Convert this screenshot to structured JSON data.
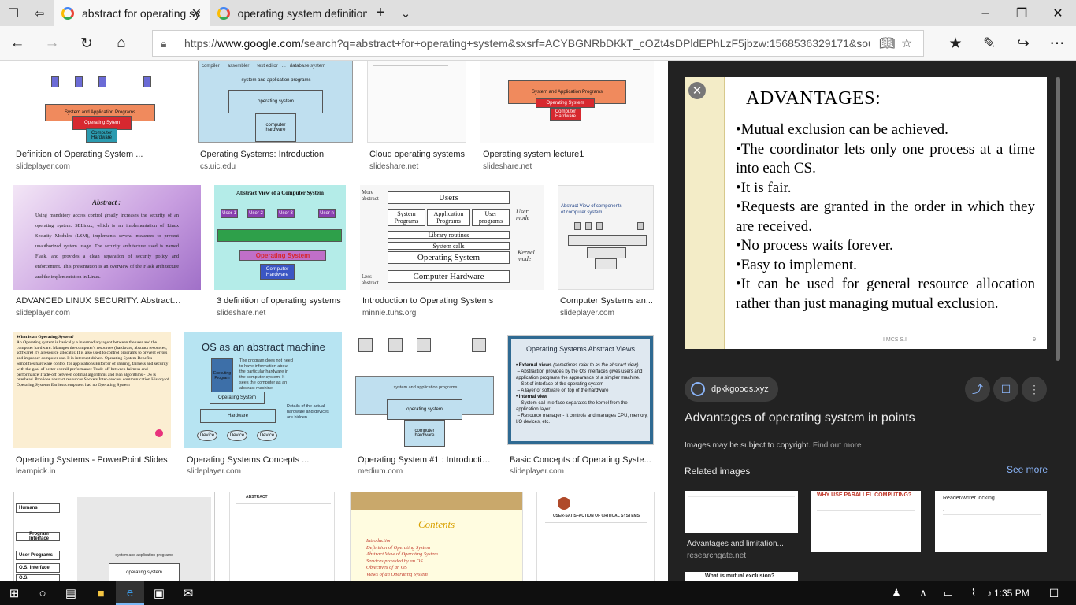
{
  "tabs": [
    {
      "title": "abstract for operating sy",
      "active": true
    },
    {
      "title": "operating system definition",
      "active": false
    }
  ],
  "address": {
    "url_prefix": "https://",
    "url_host": "www.google.com",
    "url_rest": "/search?q=abstract+for+operating+system&sxsrf=ACYBGNRbDKkT_cOZt4sDPldEPhLzF5jbzw:1568536329171&source=lnms&tl"
  },
  "results": [
    {
      "title": "Definition of Operating System ...",
      "source": "slideplayer.com"
    },
    {
      "title": "Operating Systems: Introduction",
      "source": "cs.uic.edu"
    },
    {
      "title": "Cloud operating systems",
      "source": "slideshare.net"
    },
    {
      "title": "Operating system lecture1",
      "source": "slideshare.net"
    },
    {
      "title": "ADVANCED LINUX SECURITY. Abstract ...",
      "source": "slideplayer.com"
    },
    {
      "title": "3 definition of operating systems",
      "source": "slideshare.net"
    },
    {
      "title": "Introduction to Operating Systems",
      "source": "minnie.tuhs.org"
    },
    {
      "title": "Computer Systems an...",
      "source": "slideplayer.com"
    },
    {
      "title": "Operating Systems - PowerPoint Slides",
      "source": "learnpick.in"
    },
    {
      "title": "Operating Systems Concepts ...",
      "source": "slideplayer.com"
    },
    {
      "title": "Operating System #1 : Introductio...",
      "source": "medium.com"
    },
    {
      "title": "Basic Concepts of Operating Syste...",
      "source": "slideplayer.com"
    }
  ],
  "thumbs": {
    "t1": {
      "sys": "System and Application Programs",
      "os": "Operating Sytem",
      "hw": "Computer Hardware"
    },
    "t2": {
      "compiler": "compiler",
      "assembler": "assembler",
      "text_editor": "text editor",
      "database": "database system",
      "sap": "system and application programs",
      "os": "operating system",
      "hw": "computer hardware"
    },
    "t4": {
      "sap": "System and Application Programs",
      "os": "Operating System",
      "hw": "Computer Hardware"
    },
    "t5": {
      "head": "Abstract :",
      "body": "Using mandatory access control greatly increases the security of an operating system. SELinux, which is an implementation of Linux Security Modules (LSM), implements several measures to prevent unauthorized system usage. The security architecture used is named Flask, and provides a clean separation of security policy and enforcement. This presentation is an overview of the Flask architecture and the implementation in Linux."
    },
    "t6": {
      "title": "Abstract View of a Computer System",
      "os": "Operating System",
      "hw": "Computer Hardware"
    },
    "t7": {
      "more": "More abstract",
      "less": "Less abstract",
      "users": "Users",
      "sys_prog": "System Programs",
      "app_prog": "Application Programs",
      "user_prog": "User programs",
      "user_mode": "User mode",
      "libs": "Library routines",
      "calls": "System calls",
      "os": "Operating System",
      "kernel": "Kernel mode",
      "hw": "Computer Hardware"
    },
    "t8": {
      "title": "Abstract View of components of computer system"
    },
    "t9": {
      "head": "What is an Operating System?",
      "body": "An Operating system is basically a intermediary agent between the user and the computer hardware. Manages the computer's resources (hardware, abstract resources, software) It's a resource allocator. It is also used to control programs to prevent errors and improper computer use. It is interrupt driven. Operating System Benefits Simplifies hardware control for applications Enforcer of sharing, fairness and security with the goal of better overall performance Trade-off between fairness and performance Trade-off between optimal algorithms and lean algorithms - OS is overhead. Provides abstract resources Sockets Inter-process communication History of Operating Systems Earliest computers had no Operating System"
    },
    "t10": {
      "title": "OS as an abstract machine",
      "desc": "The program does not need to have information about the particular hardware in the computer system. It sees the computer as an abstract machine.",
      "prog": "Executing Program",
      "os": "Operating System",
      "hw": "Hardware",
      "details": "Details of the actual hardware and devices are hidden.",
      "device": "Device"
    },
    "t12": {
      "title": "Operating Systems Abstract Views",
      "ext": "External views",
      "ext_note": "(sometimes refer to as the abstract view)",
      "b1": "Abstraction provides by the OS interfaces gives users and application programs the appearance of a simpler machine.",
      "b2": "Set of interface of the operating system",
      "b3": "A layer of software on top of the hardware",
      "int": "Internal view",
      "b4": "System call interface separates the kernel from the application layer",
      "b5": "Resource manager - It controls and manages CPU, memory, I/O devices, etc."
    },
    "t13": {
      "humans": "Humans",
      "pi": "Program Interface",
      "up": "User Programs",
      "osi": "O.S. Interface",
      "os": "O.S.",
      "sap": "system and application programs",
      "osys": "operating system"
    },
    "t14": {
      "head": "ABSTRACT"
    },
    "t15": {
      "contents": "Contents",
      "items": [
        "Introduction",
        "Definition of Operating System",
        "Abstract View of Operating System",
        "Services provided by an OS",
        "Objectives of an OS",
        "Views of an Operating System"
      ]
    },
    "t16": {
      "head": "USER-SATISFACTION OF CRITICAL SYSTEMS"
    }
  },
  "preview": {
    "slide_title": "ADVANTAGES:",
    "bullets": [
      "•Mutual exclusion can be achieved.",
      "•The coordinator lets only one process at a time into each CS.",
      "•It is fair.",
      "•Requests are granted in the order in which they are received.",
      "•No process waits forever.",
      "•Easy to implement.",
      "•It can be used for general resource allocation rather than just managing mutual exclusion."
    ],
    "footer": "I MCS S.I",
    "page": "9",
    "source_domain": "dpkkgoods.xyz",
    "title": "Advantages of operating system in points",
    "copyright": "Images may be subject to copyright.",
    "find_out_more": "Find out more",
    "related_heading": "Related images",
    "see_more": "See more",
    "related": [
      {
        "caption": "Advantages and limitation...",
        "source": "researchgate.net"
      },
      {
        "caption": "",
        "source": "",
        "head": "WHY USE PARALLEL COMPUTING?"
      },
      {
        "caption": "",
        "source": "",
        "head": "Reader/writer locking"
      }
    ],
    "related_bottom": "What is mutual exclusion?"
  },
  "taskbar": {
    "time": "1:35 PM"
  },
  "colors": {
    "os_red": "#d7282f",
    "hw_teal": "#2b9bb0",
    "box_blue": "#bfdfef",
    "panel_bg": "#222222",
    "link_blue": "#8ab4f8"
  }
}
